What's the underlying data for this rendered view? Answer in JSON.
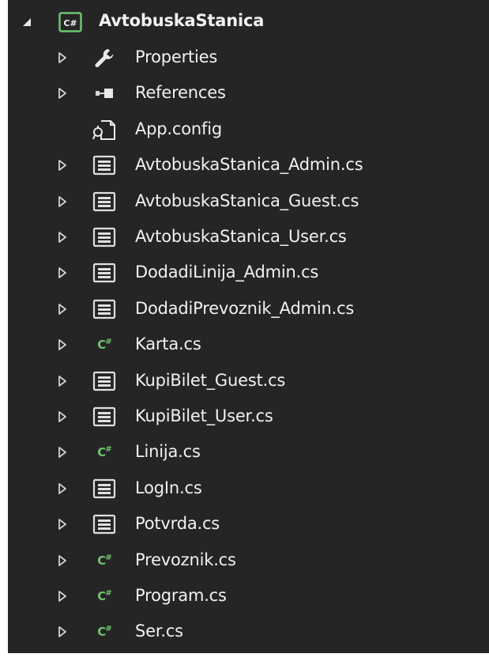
{
  "solution_explorer": {
    "project": {
      "name": "AvtobuskaStanica",
      "icon": "csharp-project-icon",
      "expanded": true
    },
    "items": [
      {
        "label": "Properties",
        "icon": "wrench-icon",
        "expandable": true
      },
      {
        "label": "References",
        "icon": "references-icon",
        "expandable": true
      },
      {
        "label": "App.config",
        "icon": "config-file-icon",
        "expandable": false
      },
      {
        "label": "AvtobuskaStanica_Admin.cs",
        "icon": "form-icon",
        "expandable": true
      },
      {
        "label": "AvtobuskaStanica_Guest.cs",
        "icon": "form-icon",
        "expandable": true
      },
      {
        "label": "AvtobuskaStanica_User.cs",
        "icon": "form-icon",
        "expandable": true
      },
      {
        "label": "DodadiLinija_Admin.cs",
        "icon": "form-icon",
        "expandable": true
      },
      {
        "label": "DodadiPrevoznik_Admin.cs",
        "icon": "form-icon",
        "expandable": true
      },
      {
        "label": "Karta.cs",
        "icon": "csharp-file-icon",
        "expandable": true
      },
      {
        "label": "KupiBilet_Guest.cs",
        "icon": "form-icon",
        "expandable": true
      },
      {
        "label": "KupiBilet_User.cs",
        "icon": "form-icon",
        "expandable": true
      },
      {
        "label": "Linija.cs",
        "icon": "csharp-file-icon",
        "expandable": true
      },
      {
        "label": "LogIn.cs",
        "icon": "form-icon",
        "expandable": true
      },
      {
        "label": "Potvrda.cs",
        "icon": "form-icon",
        "expandable": true
      },
      {
        "label": "Prevoznik.cs",
        "icon": "csharp-file-icon",
        "expandable": true
      },
      {
        "label": "Program.cs",
        "icon": "csharp-file-icon",
        "expandable": true
      },
      {
        "label": "Ser.cs",
        "icon": "csharp-file-icon",
        "expandable": true
      }
    ]
  },
  "colors": {
    "background": "#252526",
    "text": "#f1f1f1",
    "csharp_green": "#6fc46f",
    "expander": "#d0d0d0"
  }
}
